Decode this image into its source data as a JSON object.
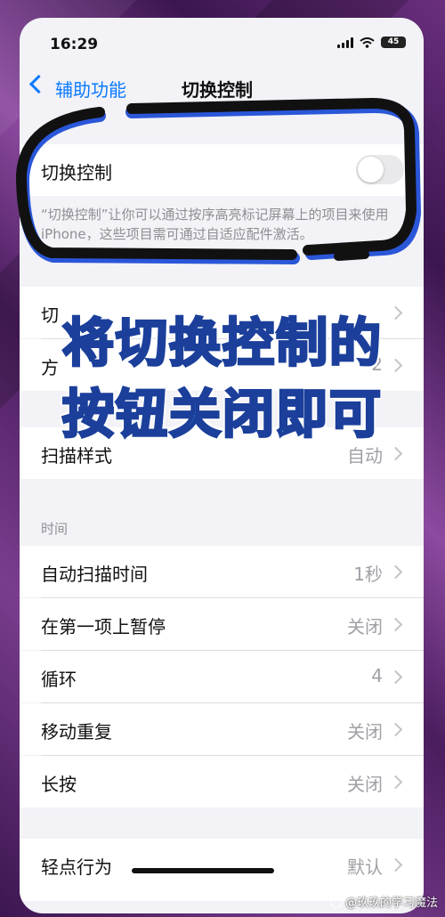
{
  "status_bar": {
    "time": "16:29",
    "battery": "45"
  },
  "nav": {
    "back_label": "辅助功能",
    "title": "切换控制"
  },
  "switch_control": {
    "label": "切换控制",
    "enabled": false,
    "description": "“切换控制”让你可以通过按序高亮标记屏幕上的项目来使用 iPhone，这些项目需可通过自适应配件激活。"
  },
  "obscured_rows": [
    {
      "label": "切",
      "value": ""
    },
    {
      "label": "方",
      "value": "2"
    }
  ],
  "scan_style": {
    "label": "扫描样式",
    "value": "自动"
  },
  "timing_section": {
    "header": "时间",
    "rows": [
      {
        "label": "自动扫描时间",
        "value": "1秒"
      },
      {
        "label": "在第一项上暂停",
        "value": "关闭"
      },
      {
        "label": "循环",
        "value": "4"
      },
      {
        "label": "移动重复",
        "value": "关闭"
      },
      {
        "label": "长按",
        "value": "关闭"
      }
    ]
  },
  "tap_behavior": {
    "label": "轻点行为",
    "value": "默认"
  },
  "overlay": {
    "line1": "将切换控制的",
    "line2": "按钮关闭即可"
  },
  "watermark": "@玖玖的学习魔法",
  "colors": {
    "accent": "#0a7aff",
    "marker": "#111111",
    "overlay_text": "#46c3f5",
    "overlay_stroke": "#1b3f9a"
  }
}
